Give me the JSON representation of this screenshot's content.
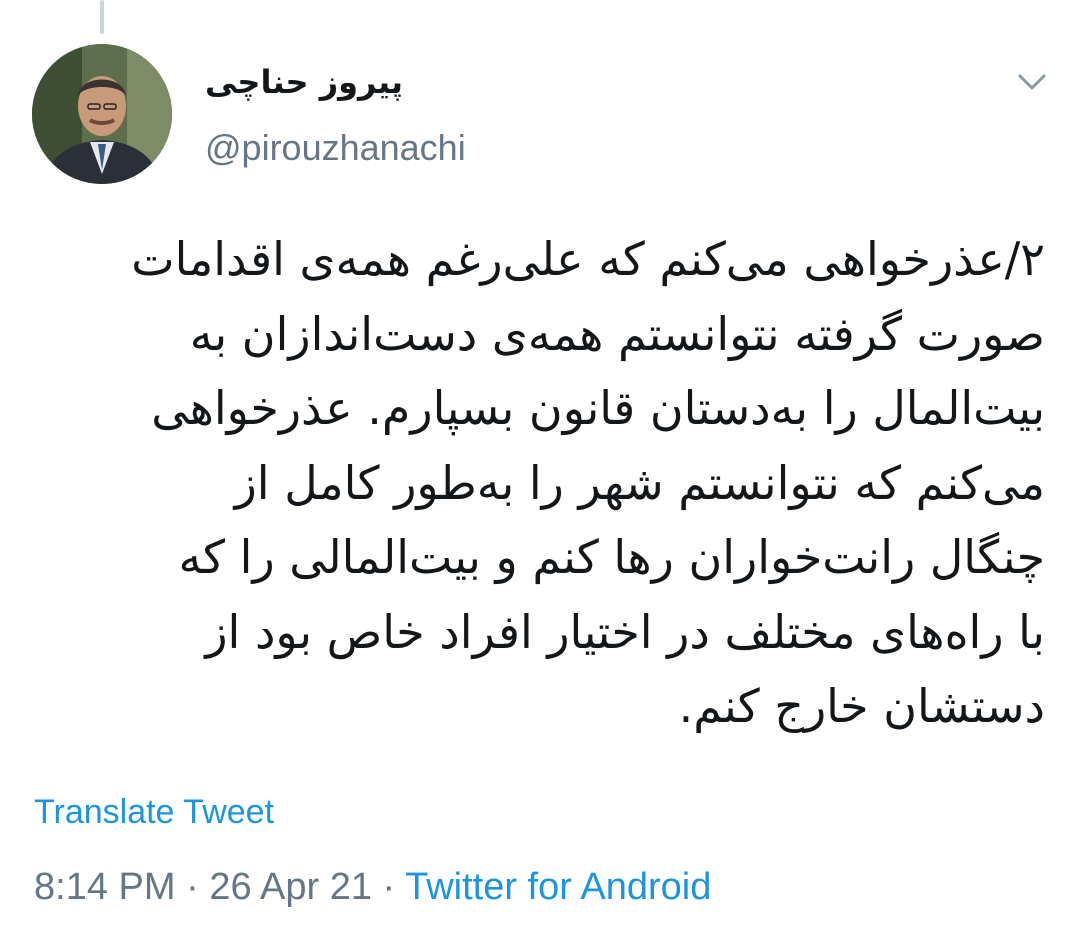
{
  "tweet": {
    "author": {
      "display_name": "پیروز حناچی",
      "handle": "@pirouzhanachi"
    },
    "text_lines": [
      "۲/عذرخواهی می‌کنم که علی‌رغم همه‌ی اقدامات",
      "صورت گرفته نتوانستم همه‌ی دست‌اندازان به",
      "بیت‌المال را به‌دستان قانون بسپارم. عذرخواهی",
      "می‌کنم که نتوانستم شهر را به‌طور کامل از",
      "چنگال رانت‌خواران رها کنم و بیت‌المالی را که",
      "با راه‌های مختلف در اختیار افراد خاص بود از",
      "دستشان خارج کنم."
    ],
    "translate_label": "Translate Tweet",
    "time": "8:14 PM",
    "separator": " · ",
    "date": "26 Apr 21",
    "source": "Twitter for Android"
  },
  "icons": {
    "caret": "chevron-down-icon",
    "avatar": "profile-photo"
  },
  "colors": {
    "text": "#14171a",
    "secondary": "#657786",
    "link": "#1b95e0",
    "thread_line": "#ccd6dd"
  }
}
